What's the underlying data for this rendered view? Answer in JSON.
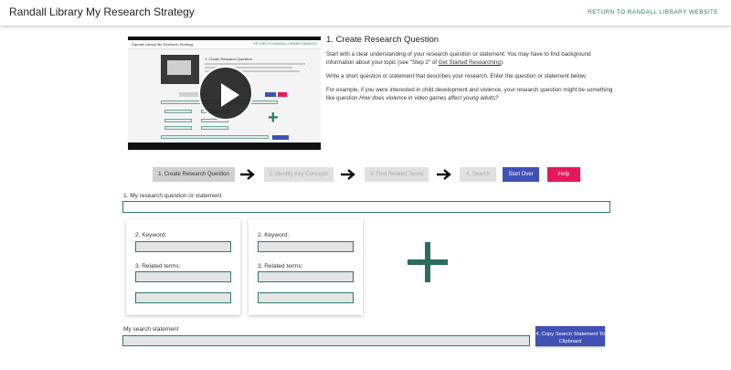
{
  "header": {
    "title": "Randall Library My Research Strategy",
    "return_link": "RETURN TO RANDALL LIBRARY WEBSITE"
  },
  "video": {
    "play_icon": "play-icon",
    "frame_title": "Randall Library My Research Strategy",
    "frame_link": "RETURN TO RANDALL LIBRARY WEBSITE",
    "frame_heading": "1. Create Research Question"
  },
  "instructions": {
    "heading": "1. Create Research Question",
    "p1_before": "Start with a clear understanding of your research question or statement. You may have to find background information about your topic (see \"Step 2\" of ",
    "p1_link": "Get Started Researching",
    "p1_after": ").",
    "p2": "Write a short question or statement that describes your research. Enter the question or statement below.",
    "p3_before": "For example, if you were interested in child development and violence, your research question might be something like question ",
    "p3_em": "How does violence in video games affect young adults?"
  },
  "steps": {
    "step1": "1. Create Research Question",
    "step2": "2. Identify Key Concepts",
    "step3": "3. Find Related Terms",
    "step4": "4. Search",
    "start_over": "Start Over",
    "help": "Help"
  },
  "form": {
    "question_label": "1. My research question or statement",
    "question_value": "",
    "cards": [
      {
        "keyword_label": "2. Keyword:",
        "related_label": "3. Related terms:"
      },
      {
        "keyword_label": "2. Keyword:",
        "related_label": "3. Related terms:"
      }
    ],
    "search_statement_label": "My search statement",
    "search_statement_value": "",
    "copy_button": "4. Copy Search Statement To Clipboard"
  },
  "colors": {
    "accent_teal": "#2c7a6c",
    "primary_blue": "#3f51b5",
    "help_pink": "#e6175a"
  }
}
